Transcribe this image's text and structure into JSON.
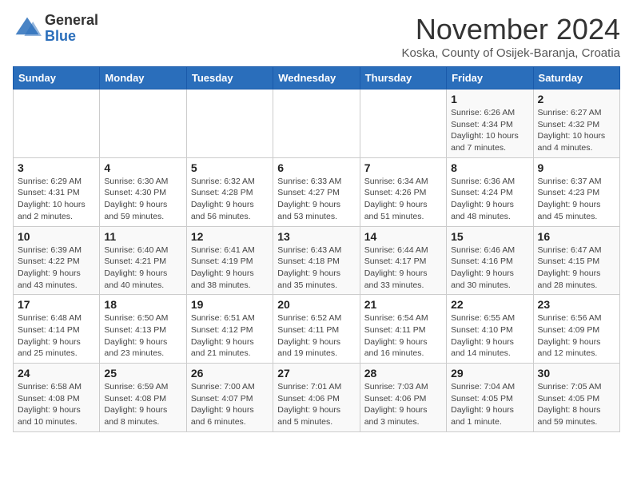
{
  "logo": {
    "general": "General",
    "blue": "Blue"
  },
  "title": "November 2024",
  "subtitle": "Koska, County of Osijek-Baranja, Croatia",
  "days_of_week": [
    "Sunday",
    "Monday",
    "Tuesday",
    "Wednesday",
    "Thursday",
    "Friday",
    "Saturday"
  ],
  "weeks": [
    [
      {
        "day": "",
        "info": ""
      },
      {
        "day": "",
        "info": ""
      },
      {
        "day": "",
        "info": ""
      },
      {
        "day": "",
        "info": ""
      },
      {
        "day": "",
        "info": ""
      },
      {
        "day": "1",
        "info": "Sunrise: 6:26 AM\nSunset: 4:34 PM\nDaylight: 10 hours and 7 minutes."
      },
      {
        "day": "2",
        "info": "Sunrise: 6:27 AM\nSunset: 4:32 PM\nDaylight: 10 hours and 4 minutes."
      }
    ],
    [
      {
        "day": "3",
        "info": "Sunrise: 6:29 AM\nSunset: 4:31 PM\nDaylight: 10 hours and 2 minutes."
      },
      {
        "day": "4",
        "info": "Sunrise: 6:30 AM\nSunset: 4:30 PM\nDaylight: 9 hours and 59 minutes."
      },
      {
        "day": "5",
        "info": "Sunrise: 6:32 AM\nSunset: 4:28 PM\nDaylight: 9 hours and 56 minutes."
      },
      {
        "day": "6",
        "info": "Sunrise: 6:33 AM\nSunset: 4:27 PM\nDaylight: 9 hours and 53 minutes."
      },
      {
        "day": "7",
        "info": "Sunrise: 6:34 AM\nSunset: 4:26 PM\nDaylight: 9 hours and 51 minutes."
      },
      {
        "day": "8",
        "info": "Sunrise: 6:36 AM\nSunset: 4:24 PM\nDaylight: 9 hours and 48 minutes."
      },
      {
        "day": "9",
        "info": "Sunrise: 6:37 AM\nSunset: 4:23 PM\nDaylight: 9 hours and 45 minutes."
      }
    ],
    [
      {
        "day": "10",
        "info": "Sunrise: 6:39 AM\nSunset: 4:22 PM\nDaylight: 9 hours and 43 minutes."
      },
      {
        "day": "11",
        "info": "Sunrise: 6:40 AM\nSunset: 4:21 PM\nDaylight: 9 hours and 40 minutes."
      },
      {
        "day": "12",
        "info": "Sunrise: 6:41 AM\nSunset: 4:19 PM\nDaylight: 9 hours and 38 minutes."
      },
      {
        "day": "13",
        "info": "Sunrise: 6:43 AM\nSunset: 4:18 PM\nDaylight: 9 hours and 35 minutes."
      },
      {
        "day": "14",
        "info": "Sunrise: 6:44 AM\nSunset: 4:17 PM\nDaylight: 9 hours and 33 minutes."
      },
      {
        "day": "15",
        "info": "Sunrise: 6:46 AM\nSunset: 4:16 PM\nDaylight: 9 hours and 30 minutes."
      },
      {
        "day": "16",
        "info": "Sunrise: 6:47 AM\nSunset: 4:15 PM\nDaylight: 9 hours and 28 minutes."
      }
    ],
    [
      {
        "day": "17",
        "info": "Sunrise: 6:48 AM\nSunset: 4:14 PM\nDaylight: 9 hours and 25 minutes."
      },
      {
        "day": "18",
        "info": "Sunrise: 6:50 AM\nSunset: 4:13 PM\nDaylight: 9 hours and 23 minutes."
      },
      {
        "day": "19",
        "info": "Sunrise: 6:51 AM\nSunset: 4:12 PM\nDaylight: 9 hours and 21 minutes."
      },
      {
        "day": "20",
        "info": "Sunrise: 6:52 AM\nSunset: 4:11 PM\nDaylight: 9 hours and 19 minutes."
      },
      {
        "day": "21",
        "info": "Sunrise: 6:54 AM\nSunset: 4:11 PM\nDaylight: 9 hours and 16 minutes."
      },
      {
        "day": "22",
        "info": "Sunrise: 6:55 AM\nSunset: 4:10 PM\nDaylight: 9 hours and 14 minutes."
      },
      {
        "day": "23",
        "info": "Sunrise: 6:56 AM\nSunset: 4:09 PM\nDaylight: 9 hours and 12 minutes."
      }
    ],
    [
      {
        "day": "24",
        "info": "Sunrise: 6:58 AM\nSunset: 4:08 PM\nDaylight: 9 hours and 10 minutes."
      },
      {
        "day": "25",
        "info": "Sunrise: 6:59 AM\nSunset: 4:08 PM\nDaylight: 9 hours and 8 minutes."
      },
      {
        "day": "26",
        "info": "Sunrise: 7:00 AM\nSunset: 4:07 PM\nDaylight: 9 hours and 6 minutes."
      },
      {
        "day": "27",
        "info": "Sunrise: 7:01 AM\nSunset: 4:06 PM\nDaylight: 9 hours and 5 minutes."
      },
      {
        "day": "28",
        "info": "Sunrise: 7:03 AM\nSunset: 4:06 PM\nDaylight: 9 hours and 3 minutes."
      },
      {
        "day": "29",
        "info": "Sunrise: 7:04 AM\nSunset: 4:05 PM\nDaylight: 9 hours and 1 minute."
      },
      {
        "day": "30",
        "info": "Sunrise: 7:05 AM\nSunset: 4:05 PM\nDaylight: 8 hours and 59 minutes."
      }
    ]
  ]
}
